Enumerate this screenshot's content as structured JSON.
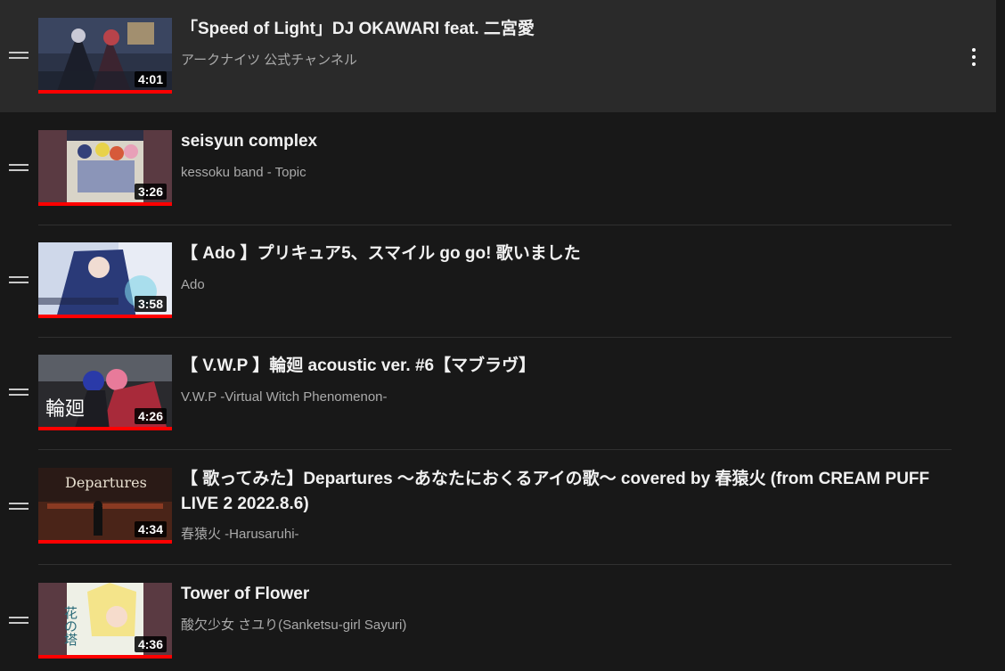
{
  "playlist": {
    "items": [
      {
        "title": "「Speed of Light」DJ OKAWARI feat. 二宮愛",
        "channel": "アークナイツ 公式チャンネル",
        "duration": "4:01",
        "watched_fraction": 1.0,
        "hovered": true,
        "thumb_icon": "anime-night-scene-thumbnail"
      },
      {
        "title": "seisyun complex",
        "channel": "kessoku band - Topic",
        "duration": "3:26",
        "watched_fraction": 1.0,
        "hovered": false,
        "thumb_icon": "album-cover-thumbnail"
      },
      {
        "title": "【 Ado 】プリキュア5、スマイル go go! 歌いました",
        "channel": "Ado",
        "duration": "3:58",
        "watched_fraction": 1.0,
        "hovered": false,
        "thumb_icon": "blue-haired-singer-thumbnail"
      },
      {
        "title": "【 V.W.P 】輪廻 acoustic ver. #6【マブラヴ】",
        "channel": "V.W.P -Virtual Witch Phenomenon-",
        "duration": "4:26",
        "watched_fraction": 1.0,
        "hovered": false,
        "thumb_icon": "duo-singers-thumbnail"
      },
      {
        "title": "【 歌ってみた】Departures 〜あなたにおくるアイの歌〜 covered by 春猿火 (from CREAM PUFF LIVE 2 2022.8.6)",
        "channel": "春猿火 -Harusaruhi-",
        "duration": "4:34",
        "watched_fraction": 1.0,
        "hovered": false,
        "thumb_icon": "live-stage-thumbnail"
      },
      {
        "title": "Tower of Flower",
        "channel": "酸欠少女 さユり(Sanketsu-girl Sayuri)",
        "duration": "4:36",
        "watched_fraction": 1.0,
        "hovered": false,
        "thumb_icon": "flower-tower-art-thumbnail"
      }
    ]
  },
  "thumb_text": {
    "departures_logo": "Departures",
    "rinne_logo": "輪廻",
    "tower_logo": "花の塔"
  },
  "colors": {
    "background": "#181818",
    "hover": "#2a2a2a",
    "progress": "#ff0000",
    "title": "#f1f1f1",
    "channel": "#aaaaaa"
  }
}
